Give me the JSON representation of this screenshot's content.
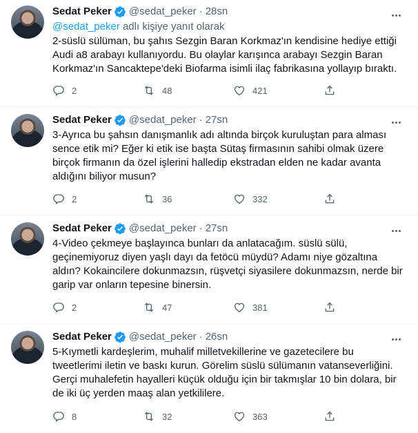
{
  "colors": {
    "accent": "#1d9bf0",
    "secondary_text": "#536471",
    "primary_text": "#0f1419",
    "divider": "#eff3f4"
  },
  "tweets": [
    {
      "name": "Sedat Peker",
      "handle": "@sedat_peker",
      "separator": "·",
      "time": "28sn",
      "reply_mention": "@sedat_peker",
      "reply_suffix": " adlı kişiye yanıt olarak",
      "text": "2-süslü sülüman, bu şahıs Sezgin Baran Korkmaz'ın kendisine hediye ettiği Audi a8 arabayı kullanıyordu. Bu olaylar karışınca arabayı Sezgin Baran Korkmaz'ın Sancaktepe'deki Biofarma isimli ilaç fabrikasına yollayıp bıraktı.",
      "replies": "2",
      "retweets": "48",
      "likes": "421"
    },
    {
      "name": "Sedat Peker",
      "handle": "@sedat_peker",
      "separator": "·",
      "time": "27sn",
      "text": "3-Ayrıca bu şahsın danışmanlık adı altında birçok kuruluştan para alması sence etik mi? Eğer ki etik ise başta Sütaş firmasının sahibi olmak üzere birçok firmanın da özel işlerini halledip ekstradan elden ne kadar avanta aldığını biliyor musun?",
      "replies": "2",
      "retweets": "36",
      "likes": "332"
    },
    {
      "name": "Sedat Peker",
      "handle": "@sedat_peker",
      "separator": "·",
      "time": "27sn",
      "text": "4-Video çekmeye başlayınca bunları da anlatacağım. süslü sülü, geçinemiyoruz diyen yaşlı dayı da fetöcü müydü? Adamı niye gözaltına aldın? Kokaincilere dokunmazsın, rüşvetçi siyasilere dokunmazsın, nerde bir garip var onların tepesine binersin.",
      "replies": "2",
      "retweets": "47",
      "likes": "381"
    },
    {
      "name": "Sedat Peker",
      "handle": "@sedat_peker",
      "separator": "·",
      "time": "26sn",
      "text": "5-Kıymetli kardeşlerim, muhalif milletvekillerine ve gazetecilere bu tweetlerimi iletin ve baskı kurun. Görelim süslü sülümanın vatanseverliğini. Gerçi muhalefetin hayalleri küçük olduğu için bir takmışlar 10 bin dolara, bir de iki üç yerden maaş alan yetkililere.",
      "replies": "8",
      "retweets": "32",
      "likes": "363"
    }
  ],
  "icons": {
    "verified": "verified-badge-icon",
    "more": "more-options-icon",
    "reply": "reply-icon",
    "retweet": "retweet-icon",
    "like": "like-heart-icon",
    "share": "share-icon"
  }
}
